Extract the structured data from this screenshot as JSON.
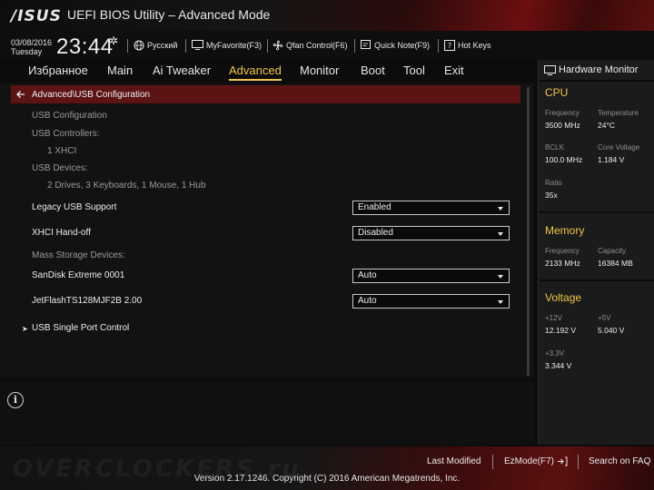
{
  "header": {
    "logo": "/ISUS",
    "title": "UEFI BIOS Utility – Advanced Mode",
    "date": "03/08/2016",
    "day": "Tuesday",
    "time": "23:44",
    "tools": {
      "language": "Русский",
      "myfavorite": "MyFavorite(F3)",
      "qfan": "Qfan Control(F6)",
      "quicknote": "Quick Note(F9)",
      "hotkeys": "Hot Keys"
    }
  },
  "menu": {
    "items": [
      "Избранное",
      "Main",
      "Ai Tweaker",
      "Advanced",
      "Monitor",
      "Boot",
      "Tool",
      "Exit"
    ],
    "active": "Advanced"
  },
  "content": {
    "breadcrumb": "Advanced\\USB Configuration",
    "usb_config_label": "USB Configuration",
    "usb_controllers_label": "USB Controllers:",
    "usb_controllers_value": "1 XHCI",
    "usb_devices_label": "USB Devices:",
    "usb_devices_value": "2 Drives, 3 Keyboards, 1 Mouse, 1 Hub",
    "legacy_usb_label": "Legacy USB Support",
    "legacy_usb_value": "Enabled",
    "xhci_label": "XHCI Hand-off",
    "xhci_value": "Disabled",
    "mass_storage_label": "Mass Storage Devices:",
    "sandisk_label": "SanDisk Extreme 0001",
    "sandisk_value": "Auto",
    "jetflash_label": "JetFlashTS128MJF2B 2.00",
    "jetflash_value": "Auto",
    "single_port_label": "USB Single Port Control"
  },
  "hw_monitor": {
    "title": "Hardware Monitor",
    "cpu": {
      "heading": "CPU",
      "frequency_label": "Frequency",
      "frequency_value": "3500 MHz",
      "temperature_label": "Temperature",
      "temperature_value": "24°C",
      "bclk_label": "BCLK",
      "bclk_value": "100.0 MHz",
      "core_voltage_label": "Core Voltage",
      "core_voltage_value": "1.184 V",
      "ratio_label": "Ratio",
      "ratio_value": "35x"
    },
    "memory": {
      "heading": "Memory",
      "frequency_label": "Frequency",
      "frequency_value": "2133 MHz",
      "capacity_label": "Capacity",
      "capacity_value": "16384 MB"
    },
    "voltage": {
      "heading": "Voltage",
      "v12_label": "+12V",
      "v12_value": "12.192 V",
      "v5_label": "+5V",
      "v5_value": "5.040 V",
      "v33_label": "+3.3V",
      "v33_value": "3.344 V"
    }
  },
  "footer": {
    "watermark": "OVERCLOCKERS.ru",
    "last_modified": "Last Modified",
    "ezmode": "EzMode(F7)",
    "search_faq": "Search on FAQ",
    "version": "Version 2.17.1246. Copyright (C) 2016 American Megatrends, Inc."
  },
  "colors": {
    "accent": "#f0c64a",
    "breadcrumb_bg": "#5b1314",
    "brand_red": "#6b0f10"
  }
}
